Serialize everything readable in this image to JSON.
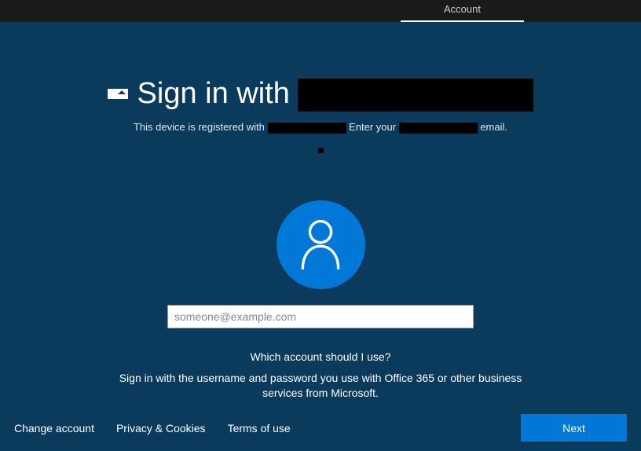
{
  "topbar": {
    "tab_label": "Account"
  },
  "header": {
    "title_prefix": "Sign in with",
    "subtitle_prefix": "This device is registered with",
    "subtitle_mid": " Enter your ",
    "subtitle_suffix": " email."
  },
  "form": {
    "email_placeholder": "someone@example.com",
    "hint": "Which account should I use?",
    "hint2": "Sign in with the username and password you use with Office 365 or other business services from Microsoft."
  },
  "footer": {
    "change_account": "Change account",
    "privacy": "Privacy & Cookies",
    "terms": "Terms of use",
    "next": "Next"
  }
}
